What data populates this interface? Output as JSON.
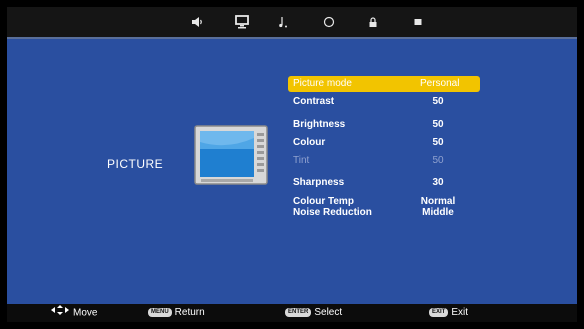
{
  "tabs": [
    {
      "icon": "speaker-icon"
    },
    {
      "icon": "monitor-icon"
    },
    {
      "icon": "music-note-icon"
    },
    {
      "icon": "clock-icon"
    },
    {
      "icon": "lock-icon"
    },
    {
      "icon": "square-icon"
    }
  ],
  "section": {
    "title": "PICTURE"
  },
  "menu": {
    "picture_mode": {
      "label": "Picture  mode",
      "value": "Personal",
      "selected": true
    },
    "contrast": {
      "label": "Contrast",
      "value": "50"
    },
    "brightness": {
      "label": "Brightness",
      "value": "50"
    },
    "colour": {
      "label": "Colour",
      "value": "50"
    },
    "tint": {
      "label": "Tint",
      "value": "50",
      "disabled": true
    },
    "sharpness": {
      "label": "Sharpness",
      "value": "30"
    },
    "colour_temp": {
      "label": "Colour Temp",
      "value": "Normal"
    },
    "noise_reduction": {
      "label": "Noise Reduction",
      "value": "Middle"
    }
  },
  "footer": {
    "move": {
      "label": "Move"
    },
    "return": {
      "key": "MENU",
      "label": "Return"
    },
    "select": {
      "key": "ENTER",
      "label": "Select"
    },
    "exit": {
      "key": "EXIT",
      "label": "Exit"
    }
  },
  "colors": {
    "background": "#2a4fa0",
    "highlight": "#f2c400",
    "bar": "#151515"
  }
}
